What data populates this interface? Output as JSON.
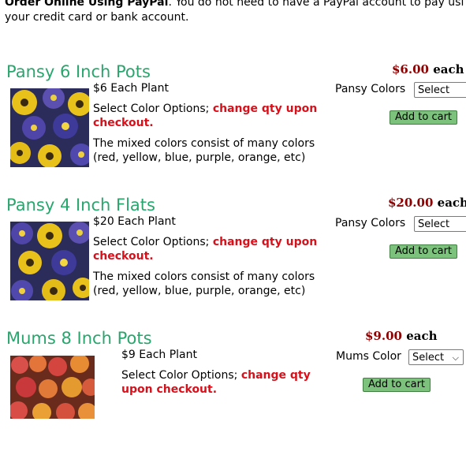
{
  "intro": {
    "bold_text": "Order Online Using PayPal",
    "rest_line1": ". You do not need to have a PayPal account to pay usi",
    "line2": "your credit card or bank account."
  },
  "products": [
    {
      "title": "Pansy 6 Inch Pots",
      "each_plant": "$6 Each Plant",
      "select_prefix": "Select Color Options; ",
      "select_red": "change qty upon checkout.",
      "mixed": "The mixed colors consist of many colors (red, yellow, blue, purple, orange, etc)",
      "price": "$6.00",
      "each": " each",
      "option_label": "Pansy Colors",
      "select_value": "Select",
      "cart_label": "Add to cart"
    },
    {
      "title": "Pansy 4 Inch Flats",
      "each_plant": "$20 Each Plant",
      "select_prefix": "Select Color Options; ",
      "select_red": "change qty upon checkout.",
      "mixed": "The mixed colors consist of many colors (red, yellow, blue, purple, orange, etc)",
      "price": "$20.00",
      "each": " each",
      "option_label": "Pansy Colors",
      "select_value": "Select",
      "cart_label": "Add to cart"
    },
    {
      "title": "Mums 8 Inch Pots",
      "each_plant": "$9 Each Plant",
      "select_prefix": "Select Color Options; ",
      "select_red": "change qty upon checkout.",
      "price": "$9.00",
      "each": " each",
      "option_label": "Mums Color",
      "select_value": "Select",
      "cart_label": "Add to cart"
    }
  ],
  "colors": {
    "title_green": "#2aa56e",
    "price_red": "#8b0000",
    "alert_red": "#d7111b",
    "button_green": "#7cc27c"
  }
}
